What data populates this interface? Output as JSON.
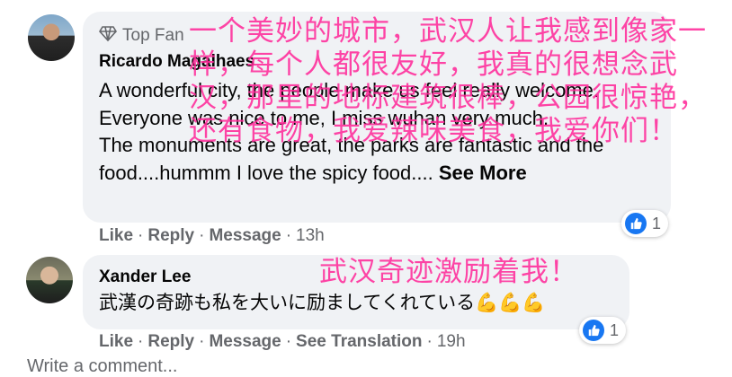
{
  "comments": [
    {
      "badge": "Top Fan",
      "author": "Ricardo Magalhaes",
      "lines": [
        "A wonderful city, the people make us feel really welcome.",
        "Everyone was nice to me, I miss wuhan very much.",
        "The monuments are great, the parks are fantastic and the food....hummm I love the spicy food...."
      ],
      "see_more": "See More",
      "actions": {
        "like": "Like",
        "reply": "Reply",
        "message": "Message",
        "time": "13h"
      },
      "reactions": "1",
      "overlay_lines": [
        "一个美妙的城市，武汉人让我感到像家一",
        "样，每个人都很友好，我真的很想念武",
        "汉，那里的地标建筑很棒，公园很惊艳，",
        "还有食物，我爱辣味美食，我爱你们！"
      ]
    },
    {
      "author": "Xander Lee",
      "text": "武漢の奇跡も私を大いに励ましてくれている💪💪💪",
      "actions": {
        "like": "Like",
        "reply": "Reply",
        "message": "Message",
        "translate": "See Translation",
        "time": "19h"
      },
      "reactions": "1",
      "overlay_lines": [
        "武汉奇迹激励着我！"
      ]
    }
  ],
  "write_comment": "Write a comment...",
  "colors": {
    "overlay": "#ff2b9a",
    "like_blue": "#1877f2",
    "bubble": "#f0f2f5"
  }
}
